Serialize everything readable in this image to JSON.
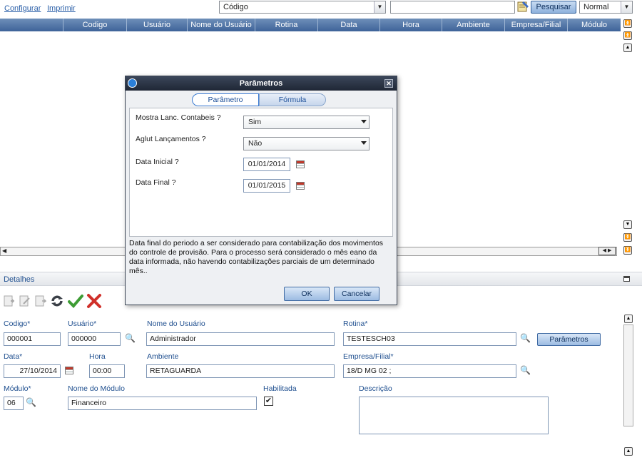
{
  "toolbar": {
    "configurar": "Configurar",
    "imprimir": "Imprimir",
    "search_field": "Código",
    "search_button": "Pesquisar",
    "view_mode": "Normal"
  },
  "grid": {
    "columns": [
      "Codigo",
      "Usuário",
      "Nome do Usuário",
      "Rotina",
      "Data",
      "Hora",
      "Ambiente",
      "Empresa/Filial",
      "Módulo"
    ]
  },
  "details": {
    "title": "Detalhes",
    "labels": {
      "codigo": "Codigo*",
      "usuario": "Usuário*",
      "nome_usuario": "Nome do Usuário",
      "rotina": "Rotina*",
      "data": "Data*",
      "hora": "Hora",
      "ambiente": "Ambiente",
      "empresa": "Empresa/Filial*",
      "modulo": "Módulo*",
      "nome_modulo": "Nome do Módulo",
      "habilitada": "Habilitada",
      "descricao": "Descrição"
    },
    "values": {
      "codigo": "000001",
      "usuario": "000000",
      "nome_usuario": "Administrador",
      "rotina": "TESTESCH03",
      "data": "27/10/2014",
      "hora": "00:00",
      "ambiente": "RETAGUARDA",
      "empresa": "18/D MG 02 ;",
      "modulo": "06",
      "nome_modulo": "Financeiro",
      "descricao": ""
    },
    "habilitada_checked": true,
    "parametros_button": "Parâmetros"
  },
  "dialog": {
    "title": "Parâmetros",
    "tabs": [
      "Parâmetro",
      "Fórmula"
    ],
    "fields": [
      {
        "label": "Mostra Lanc. Contabeis ?",
        "value": "Sim"
      },
      {
        "label": "Aglut Lançamentos ?",
        "value": "Não"
      },
      {
        "label": "Data Inicial ?",
        "value": "01/01/2014"
      },
      {
        "label": "Data Final ?",
        "value": "01/01/2015"
      }
    ],
    "help_text": "Data final do periodo a ser considerado para contabilização dos movimentos do controle de provisão. Para o processo será considerado o mês eano da data informada, não havendo contabilizações parciais de um determinado mês..",
    "ok": "OK",
    "cancel": "Cancelar"
  },
  "colors": {
    "accent": "#3e6399",
    "label": "#1f4f8f",
    "dialog_title": "#1f2735"
  }
}
